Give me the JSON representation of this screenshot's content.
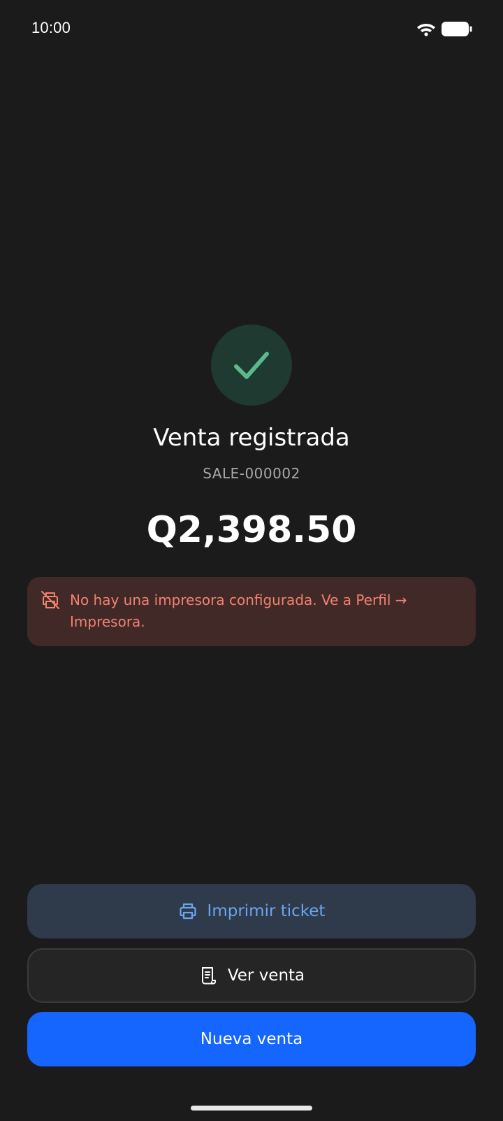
{
  "status_bar": {
    "time": "10:00",
    "wifi_icon": "wifi-icon",
    "battery_icon": "battery-icon"
  },
  "result": {
    "icon": "check-icon",
    "title": "Venta registrada",
    "sale_id": "SALE-000002",
    "amount": "Q2,398.50",
    "accent_color": "#5bb98b"
  },
  "alert": {
    "icon": "printer-off-icon",
    "message": "No hay una impresora configurada. Ve a Perfil → Impresora.",
    "text_color": "#f3826f",
    "background_color": "#412927"
  },
  "actions": {
    "print_label": "Imprimir ticket",
    "print_icon": "printer-icon",
    "view_label": "Ver venta",
    "view_icon": "receipt-icon",
    "new_label": "Nueva venta",
    "primary_color": "#1565ff"
  }
}
